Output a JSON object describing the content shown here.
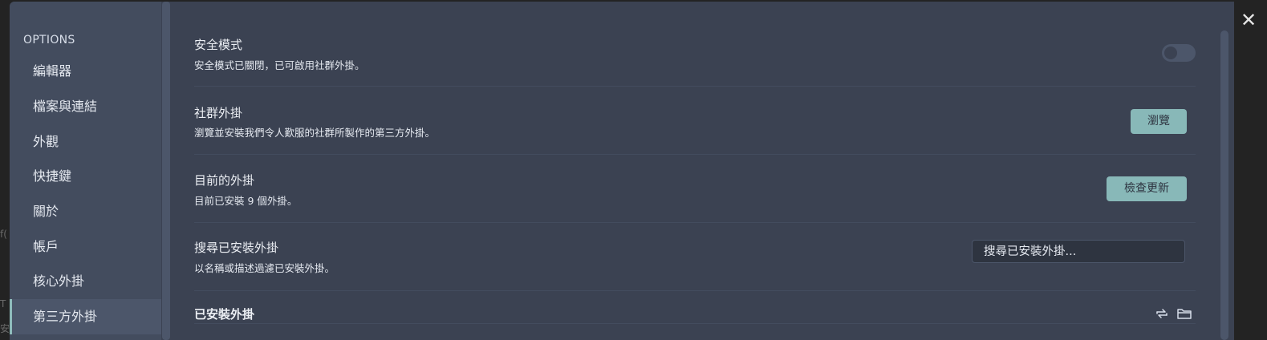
{
  "window": {
    "close_label": "✕"
  },
  "backdrop": {
    "glyph_1": "f(",
    "glyph_2": "T",
    "glyph_3": "安"
  },
  "sidebar": {
    "heading": "OPTIONS",
    "items": [
      {
        "label": "編輯器"
      },
      {
        "label": "檔案與連結"
      },
      {
        "label": "外觀"
      },
      {
        "label": "快捷鍵"
      },
      {
        "label": "關於"
      },
      {
        "label": "帳戶"
      },
      {
        "label": "核心外掛"
      },
      {
        "label": "第三方外掛",
        "active": true
      }
    ]
  },
  "settings": {
    "safe_mode": {
      "title": "安全模式",
      "description": "安全模式已關閉，已可啟用社群外掛。",
      "enabled": false
    },
    "community_plugins": {
      "title": "社群外掛",
      "description": "瀏覽並安裝我們令人歎服的社群所製作的第三方外掛。",
      "button_label": "瀏覽"
    },
    "current_plugins": {
      "title": "目前的外掛",
      "description": "目前已安裝 9 個外掛。",
      "button_label": "檢查更新"
    },
    "search_plugins": {
      "title": "搜尋已安裝外掛",
      "description": "以名稱或描述過濾已安裝外掛。",
      "placeholder": "搜尋已安裝外掛..."
    },
    "installed_plugins": {
      "title": "已安裝外掛"
    }
  },
  "colors": {
    "modal_bg": "#3b4252",
    "sidebar_bg": "#434c5e",
    "accent": "#88b8b8",
    "active_border": "#8fbcbb"
  },
  "icons": {
    "reload": "reload-icon",
    "folder": "folder-icon"
  }
}
